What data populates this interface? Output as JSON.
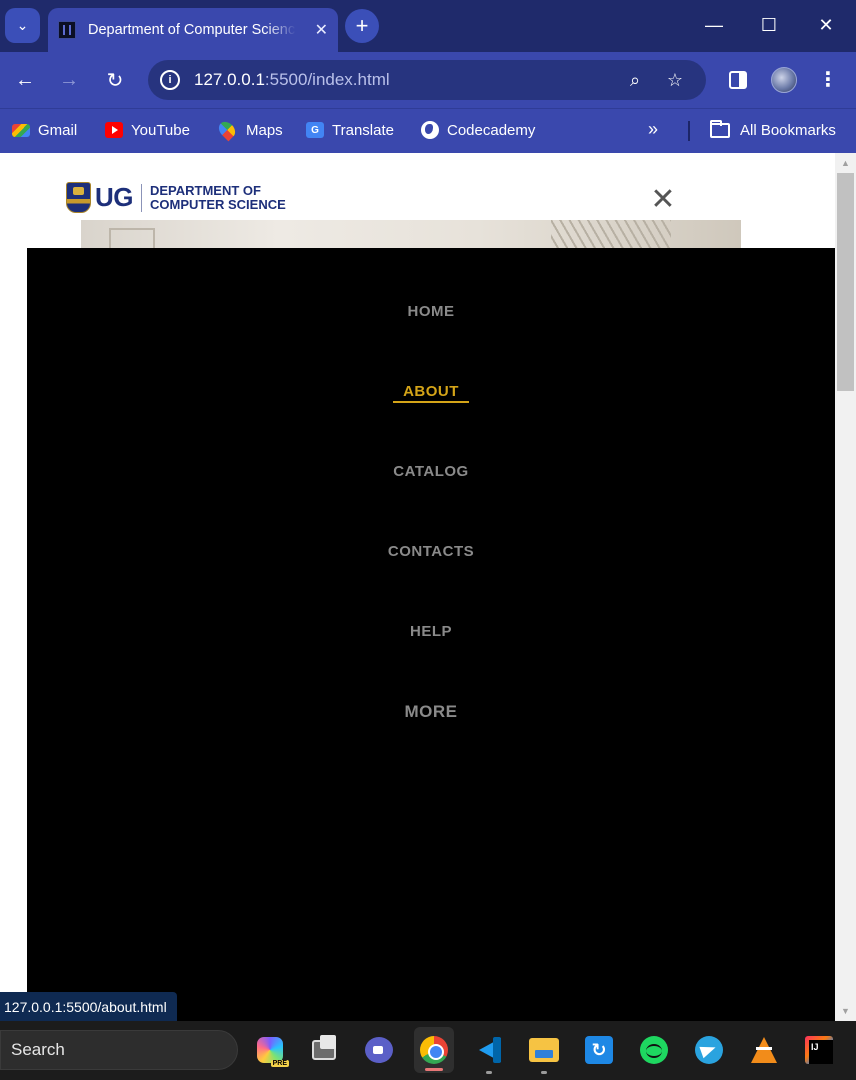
{
  "browser": {
    "tab_title": "Department of Computer Science",
    "tab_close_glyph": "✕",
    "new_tab_glyph": "+",
    "tab_search_glyph": "⌄",
    "window_controls": {
      "minimize": "—",
      "maximize": "☐",
      "close": "✕"
    },
    "url_host": "127.0.0.1",
    "url_rest": ":5500/index.html",
    "bookmarks": [
      {
        "label": "Gmail",
        "icon": "gmail-icon"
      },
      {
        "label": "YouTube",
        "icon": "youtube-icon"
      },
      {
        "label": "Maps",
        "icon": "maps-icon"
      },
      {
        "label": "Translate",
        "icon": "translate-icon"
      },
      {
        "label": "Codecademy",
        "icon": "codecademy-icon"
      }
    ],
    "all_bookmarks": "All Bookmarks",
    "status_url": "127.0.0.1:5500/about.html"
  },
  "site": {
    "logo_ug": "UG",
    "logo_line1": "DEPARTMENT OF",
    "logo_line2": "COMPUTER SCIENCE",
    "close_glyph": "✕",
    "nav": [
      {
        "label": "HOME",
        "active": false
      },
      {
        "label": "ABOUT",
        "active": true
      },
      {
        "label": "CATALOG",
        "active": false
      },
      {
        "label": "CONTACTS",
        "active": false
      },
      {
        "label": "HELP",
        "active": false
      },
      {
        "label": "MORE",
        "active": false
      }
    ],
    "accent_color": "#d4a418",
    "nav_color": "#8a8a8a"
  },
  "taskbar": {
    "search_label": "Search",
    "apps": [
      "copilot-icon",
      "task-view-icon",
      "meet-icon",
      "chrome-icon",
      "vscode-icon",
      "file-explorer-icon",
      "app-arrow-icon",
      "spotify-icon",
      "telegram-icon",
      "vlc-icon",
      "intellij-icon"
    ]
  }
}
